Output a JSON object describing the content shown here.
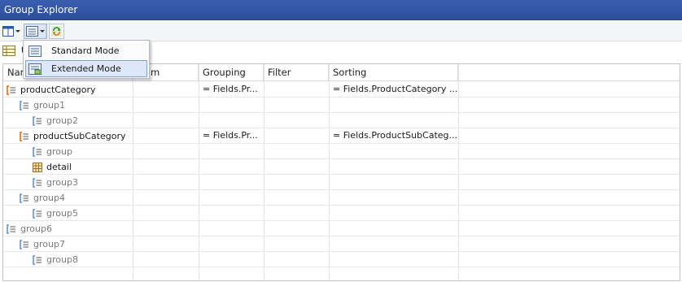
{
  "window": {
    "title": "Group Explorer"
  },
  "toolbar": {
    "view_icon": "panels-icon",
    "mode_icon": "grid-mode-icon",
    "refresh_icon": "refresh-icon"
  },
  "subbar": {
    "label": "t"
  },
  "menu": {
    "items": [
      {
        "label": "Standard Mode",
        "highlighted": false
      },
      {
        "label": "Extended Mode",
        "highlighted": true
      }
    ]
  },
  "grid": {
    "columns": [
      "Nam",
      "m",
      "Grouping",
      "Filter",
      "Sorting"
    ],
    "rows": [
      {
        "name": "productCategory",
        "level": 0,
        "kind": "group-top",
        "grouping": "= Fields.Pr...",
        "filter": "",
        "sorting": "= Fields.ProductCategory ..."
      },
      {
        "name": "group1",
        "level": 1,
        "kind": "group-gray",
        "grouping": "",
        "filter": "",
        "sorting": ""
      },
      {
        "name": "group2",
        "level": 2,
        "kind": "group-gray",
        "grouping": "",
        "filter": "",
        "sorting": ""
      },
      {
        "name": "productSubCategory",
        "level": 1,
        "kind": "group-top",
        "grouping": "= Fields.Pr...",
        "filter": "",
        "sorting": "= Fields.ProductSubCateg..."
      },
      {
        "name": "group",
        "level": 2,
        "kind": "group-gray",
        "grouping": "",
        "filter": "",
        "sorting": ""
      },
      {
        "name": "detail",
        "level": 2,
        "kind": "detail",
        "grouping": "",
        "filter": "",
        "sorting": ""
      },
      {
        "name": "group3",
        "level": 2,
        "kind": "group-gray",
        "grouping": "",
        "filter": "",
        "sorting": ""
      },
      {
        "name": "group4",
        "level": 1,
        "kind": "group-gray",
        "grouping": "",
        "filter": "",
        "sorting": ""
      },
      {
        "name": "group5",
        "level": 2,
        "kind": "group-gray",
        "grouping": "",
        "filter": "",
        "sorting": ""
      },
      {
        "name": "group6",
        "level": 0,
        "kind": "group-gray",
        "grouping": "",
        "filter": "",
        "sorting": ""
      },
      {
        "name": "group7",
        "level": 1,
        "kind": "group-gray",
        "grouping": "",
        "filter": "",
        "sorting": ""
      },
      {
        "name": "group8",
        "level": 2,
        "kind": "group-gray",
        "grouping": "",
        "filter": "",
        "sorting": ""
      }
    ]
  },
  "colors": {
    "title_bg": "#2d4f9c",
    "accent_bracket": "#e06a1b",
    "menu_highlight": "#dce8f7"
  }
}
